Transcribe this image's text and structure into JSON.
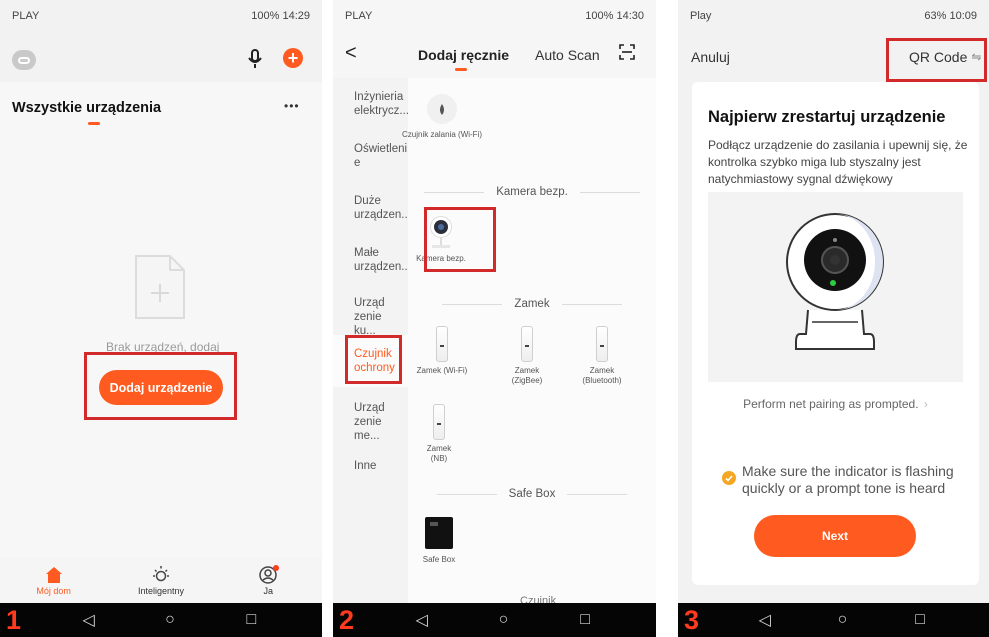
{
  "panel1": {
    "status": {
      "carrier": "PLAY",
      "right": "100%  14:29"
    },
    "title": "Wszystkie urządzenia",
    "more_label": "•••",
    "empty_text": "Brak urządzeń, dodaj",
    "add_button": "Dodaj urządzenie",
    "tabs": [
      {
        "label": "Mój dom",
        "icon": "home-icon",
        "active": true
      },
      {
        "label": "Inteligentny",
        "icon": "sun-icon",
        "active": false
      },
      {
        "label": "Ja",
        "icon": "profile-icon",
        "active": false
      }
    ],
    "step": "1",
    "accent": "#ff5a1f"
  },
  "panel2": {
    "status": {
      "carrier": "PLAY",
      "right": "100%  14:30"
    },
    "header": {
      "back": "<",
      "tab_manual": "Dodaj ręcznie",
      "tab_auto": "Auto Scan"
    },
    "categories": [
      "Inżynieria elektrycz...",
      "Oświetleni e",
      "Duże urządzen...",
      "Małe urządzen...",
      "Urząd zenie ku...",
      "Czujnik ochrony",
      "Urząd zenie me...",
      "Inne"
    ],
    "active_category": "Czujnik ochrony",
    "top_device": {
      "label": "Czujnik zalania (Wi-Fi)"
    },
    "sections": [
      {
        "title": "Kamera bezp.",
        "devices": [
          "Kamera bezp."
        ]
      },
      {
        "title": "Zamek",
        "devices": [
          "Zamek (Wi-Fi)",
          "Zamek (ZigBee)",
          "Zamek (Bluetooth)",
          "Zamek (NB)"
        ]
      },
      {
        "title": "Safe Box",
        "devices": [
          "Safe Box"
        ]
      }
    ],
    "bottom_partial": "Czujnik",
    "step": "2"
  },
  "panel3": {
    "status": {
      "carrier": "Play",
      "right": "63%  10:09"
    },
    "cancel": "Anuluj",
    "qr_code": "QR Code",
    "title": "Najpierw zrestartuj urządzenie",
    "description": "Podłącz urządzenie do zasilania i upewnij się, że kontrolka szybko miga lub styszalny jest natychmiastowy sygnal dźwiękowy",
    "pairing_link": "Perform net pairing as prompted.",
    "confirm_text": "Make sure the indicator is flashing quickly or a prompt tone is heard",
    "confirm_checked": true,
    "next": "Next",
    "step": "3"
  }
}
